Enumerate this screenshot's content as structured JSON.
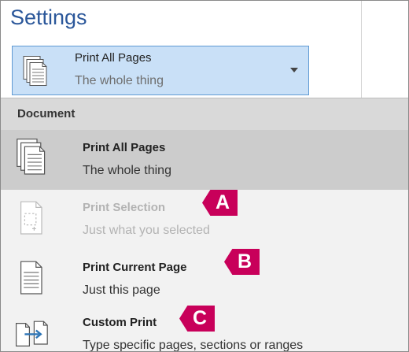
{
  "settings": {
    "title": "Settings"
  },
  "selector": {
    "line1": "Print All Pages",
    "line2": "The whole thing",
    "icon": "print-all-pages-icon"
  },
  "dropdown": {
    "section_header": "Document",
    "items": [
      {
        "title": "Print All Pages",
        "subtitle": "The whole thing",
        "icon": "print-all-pages-icon",
        "state": "selected"
      },
      {
        "title": "Print Selection",
        "subtitle": "Just what you selected",
        "icon": "print-selection-icon",
        "state": "disabled",
        "callout": "A"
      },
      {
        "title": "Print Current Page",
        "subtitle": "Just this page",
        "icon": "print-current-page-icon",
        "state": "normal",
        "callout": "B"
      },
      {
        "title": "Custom Print",
        "subtitle": "Type specific pages, sections or ranges",
        "icon": "custom-print-icon",
        "state": "normal",
        "callout": "C"
      }
    ]
  },
  "colors": {
    "title": "#2b579a",
    "selector_bg": "#c9e0f7",
    "selector_border": "#5f9ad3",
    "callout": "#c8005a",
    "custom_print_arrow": "#2e75b6"
  }
}
